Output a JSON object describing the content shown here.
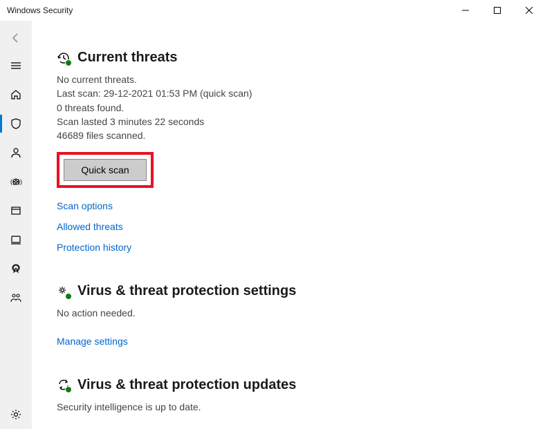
{
  "titlebar": {
    "title": "Windows Security"
  },
  "currentThreats": {
    "heading": "Current threats",
    "noThreats": "No current threats.",
    "lastScan": "Last scan: 29-12-2021 01:53 PM (quick scan)",
    "threatsFound": "0 threats found.",
    "duration": "Scan lasted 3 minutes 22 seconds",
    "filesScanned": "46689 files scanned.",
    "quickScanButton": "Quick scan",
    "scanOptionsLink": "Scan options",
    "allowedThreatsLink": "Allowed threats",
    "protectionHistoryLink": "Protection history"
  },
  "settings": {
    "heading": "Virus & threat protection settings",
    "status": "No action needed.",
    "manageLink": "Manage settings"
  },
  "updates": {
    "heading": "Virus & threat protection updates",
    "status": "Security intelligence is up to date."
  }
}
